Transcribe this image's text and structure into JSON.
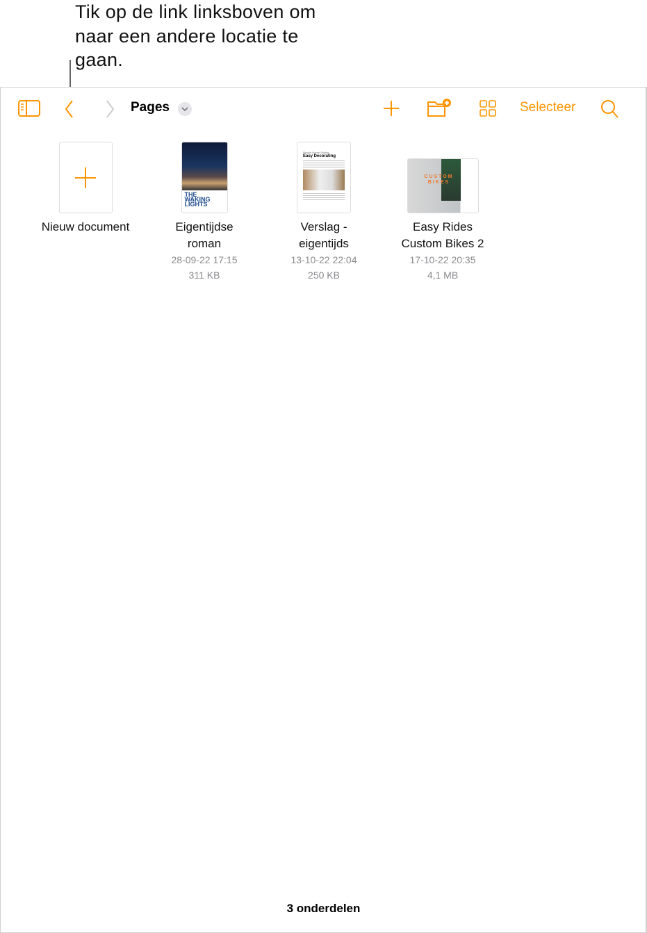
{
  "callout": {
    "text": "Tik op de link linksboven om naar een andere locatie te gaan."
  },
  "toolbar": {
    "title": "Pages",
    "select_label": "Selecteer"
  },
  "accent_color": "#FF9500",
  "items": [
    {
      "name": "Nieuw document"
    },
    {
      "name_line1": "Eigentijdse",
      "name_line2": "roman",
      "date": "28-09-22 17:15",
      "size": "311 KB",
      "thumb_title": "THE WAKING LIGHTS"
    },
    {
      "name_line1": "Verslag -",
      "name_line2": "eigentijds",
      "date": "13-10-22 22:04",
      "size": "250 KB",
      "thumb_subtitle": "Simple Home Styling",
      "thumb_title": "Easy Decorating"
    },
    {
      "name_line1": "Easy Rides",
      "name_line2": "Custom Bikes 2",
      "date": "17-10-22 20:35",
      "size": "4,1 MB",
      "thumb_title": "CUSTOM BIKES"
    }
  ],
  "footer": {
    "count": "3 onderdelen"
  }
}
